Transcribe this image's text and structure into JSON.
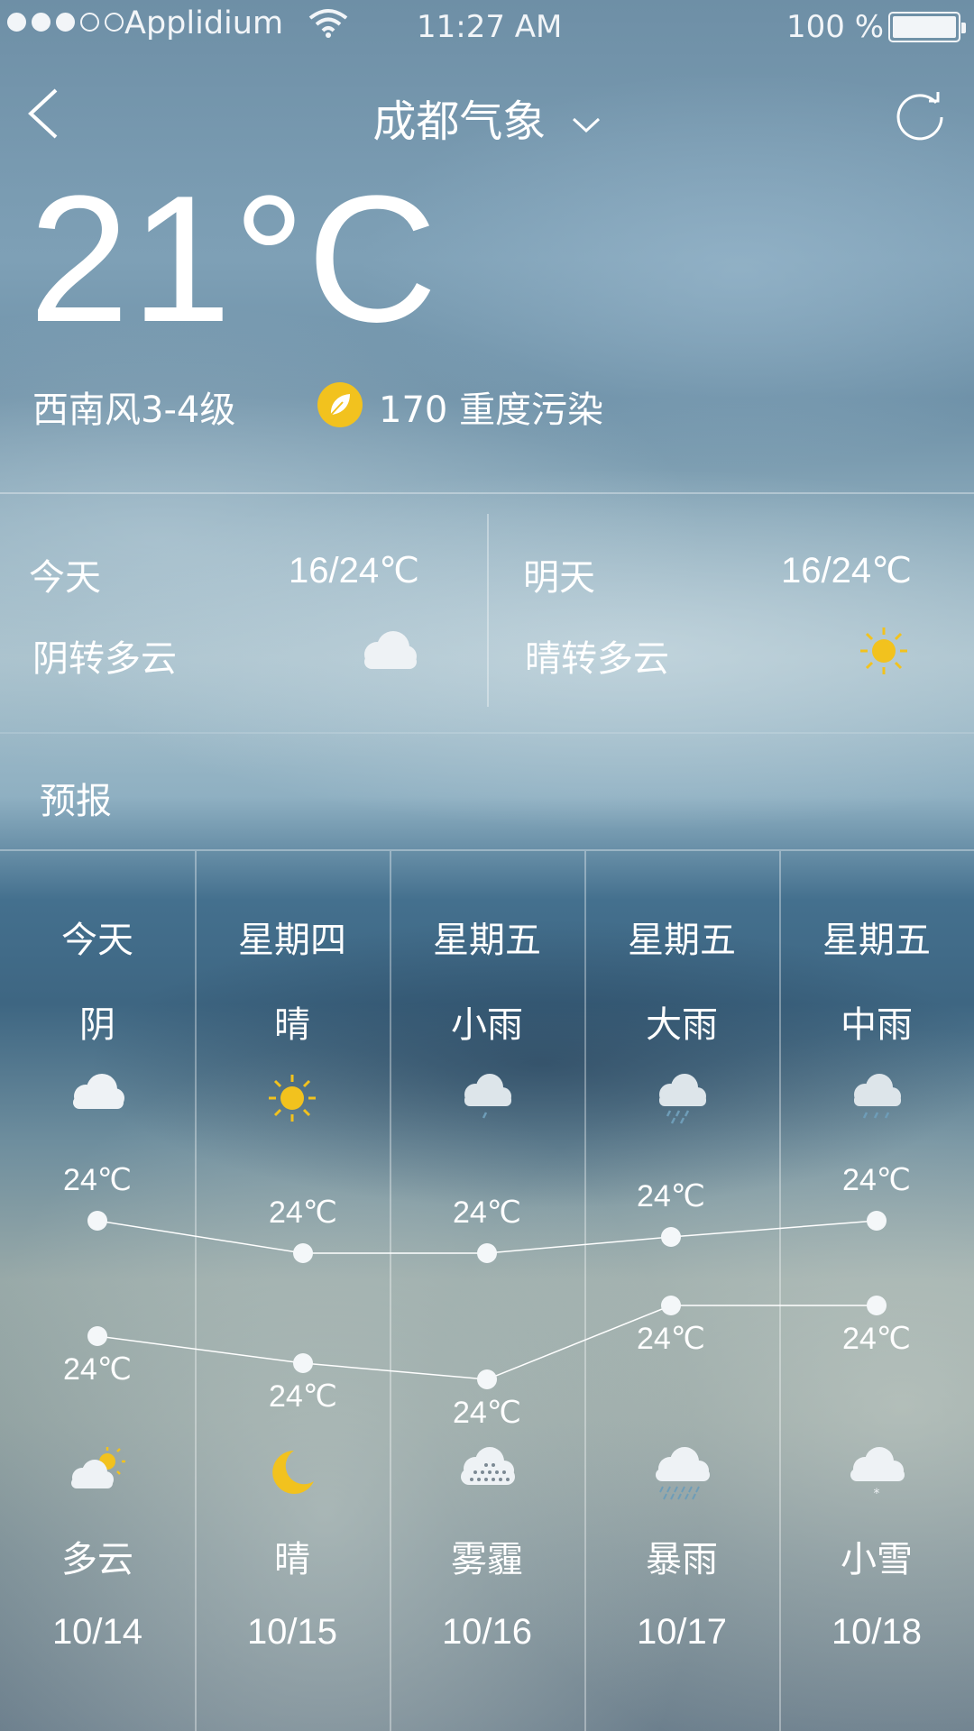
{
  "status_bar": {
    "signal_dots": [
      true,
      true,
      true,
      false,
      false
    ],
    "carrier": "Applidium",
    "time": "11:27 AM",
    "battery_percent": "100 %",
    "battery_level": 1.0
  },
  "header": {
    "city": "成都气象",
    "back_icon": "chevron-left-icon",
    "dropdown_icon": "chevron-down-icon",
    "refresh_icon": "refresh-icon"
  },
  "current": {
    "temperature": "21°C",
    "wind": "西南风3-4级",
    "aqi": "170 重度污染",
    "aqi_icon": "leaf-icon",
    "aqi_color": "#f2c21e"
  },
  "today": {
    "label": "今天",
    "range": "16/24℃",
    "condition": "阴转多云",
    "icon": "cloudy-icon"
  },
  "tomorrow": {
    "label": "明天",
    "range": "16/24℃",
    "condition": "晴转多云",
    "icon": "sun-icon"
  },
  "forecast": {
    "label": "预报",
    "days": [
      {
        "day": "今天",
        "condition_day": "阴",
        "icon_day": "cloudy-icon",
        "high": "24℃",
        "low": "24℃",
        "icon_night": "partly-cloudy-icon",
        "condition_night": "多云",
        "date": "10/14"
      },
      {
        "day": "星期四",
        "condition_day": "晴",
        "icon_day": "sun-icon",
        "high": "24℃",
        "low": "24℃",
        "icon_night": "moon-icon",
        "condition_night": "晴",
        "date": "10/15"
      },
      {
        "day": "星期五",
        "condition_day": "小雨",
        "icon_day": "light-rain-icon",
        "high": "24℃",
        "low": "24℃",
        "icon_night": "haze-icon",
        "condition_night": "雾霾",
        "date": "10/16"
      },
      {
        "day": "星期五",
        "condition_day": "大雨",
        "icon_day": "heavy-rain-icon",
        "high": "24℃",
        "low": "24℃",
        "icon_night": "storm-icon",
        "condition_night": "暴雨",
        "date": "10/17"
      },
      {
        "day": "星期五",
        "condition_day": "中雨",
        "icon_day": "moderate-rain-icon",
        "high": "24℃",
        "low": "24℃",
        "icon_night": "light-snow-icon",
        "condition_night": "小雪",
        "date": "10/18"
      }
    ]
  },
  "colors": {
    "sun": "#f2c21e",
    "cloud": "#e9eef2",
    "line": "#ffffff"
  }
}
